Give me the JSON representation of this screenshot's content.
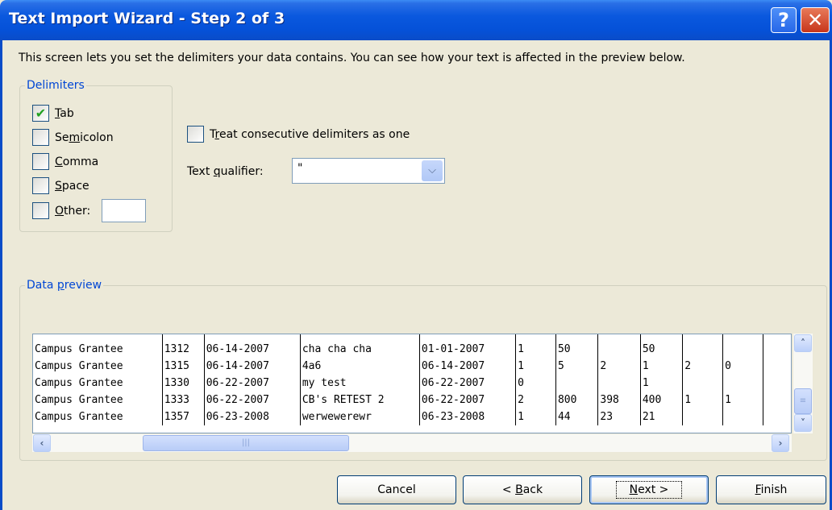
{
  "window": {
    "title": "Text Import Wizard - Step 2 of 3",
    "help_label": "?",
    "close_label": "✕"
  },
  "intro": "This screen lets you set the delimiters your data contains.  You can see how your text is affected in the preview below.",
  "delimiters": {
    "legend": "Delimiters",
    "tab": {
      "label": "Tab",
      "checked": true
    },
    "semicolon": {
      "label": "Semicolon",
      "checked": false
    },
    "comma": {
      "label": "Comma",
      "checked": false
    },
    "space": {
      "label": "Space",
      "checked": false
    },
    "other": {
      "label": "Other:",
      "checked": false,
      "value": ""
    }
  },
  "consecutive": {
    "label": "Treat consecutive delimiters as one",
    "checked": false
  },
  "qualifier": {
    "label": "Text qualifier:",
    "value": "\""
  },
  "preview": {
    "legend": "Data preview",
    "rows": [
      [
        "Campus Grantee",
        "1312",
        "06-14-2007",
        "cha cha cha",
        "01-01-2007",
        "1",
        "50",
        "",
        "50",
        "",
        "",
        ""
      ],
      [
        "Campus Grantee",
        "1315",
        "06-14-2007",
        "4a6",
        "06-14-2007",
        "1",
        "5",
        "2",
        "1",
        "2",
        "0",
        ""
      ],
      [
        "Campus Grantee",
        "1330",
        "06-22-2007",
        "my test",
        "06-22-2007",
        "0",
        "",
        "",
        "1",
        "",
        "",
        ""
      ],
      [
        "Campus Grantee",
        "1333",
        "06-22-2007",
        "CB's RETEST 2",
        "06-22-2007",
        "2",
        "800",
        "398",
        "400",
        "1",
        "1",
        ""
      ],
      [
        "Campus Grantee",
        "1357",
        "06-23-2008",
        "werwewerewr",
        "06-23-2008",
        "1",
        "44",
        "23",
        "21",
        "",
        "",
        ""
      ]
    ]
  },
  "buttons": {
    "cancel": "Cancel",
    "back": "< Back",
    "next": "Next >",
    "finish": "Finish"
  }
}
